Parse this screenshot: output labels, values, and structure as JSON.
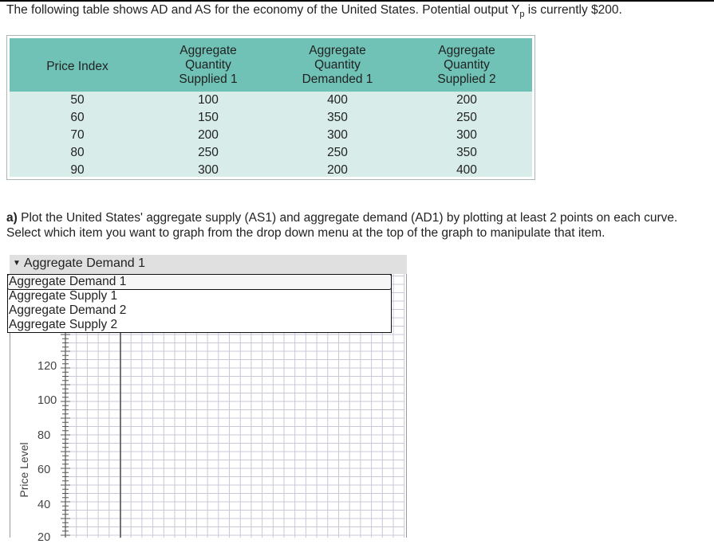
{
  "intro": {
    "text_before": "The following table shows AD and AS for the economy of the United States. Potential output Y",
    "subscript": "p",
    "text_after": " is currently $200."
  },
  "table": {
    "headers": [
      [
        "Price Index"
      ],
      [
        "Aggregate",
        "Quantity",
        "Supplied 1"
      ],
      [
        "Aggregate",
        "Quantity",
        "Demanded 1"
      ],
      [
        "Aggregate",
        "Quantity",
        "Supplied 2"
      ]
    ],
    "rows": [
      [
        "50",
        "100",
        "400",
        "200"
      ],
      [
        "60",
        "150",
        "350",
        "250"
      ],
      [
        "70",
        "200",
        "300",
        "300"
      ],
      [
        "80",
        "250",
        "250",
        "350"
      ],
      [
        "90",
        "300",
        "200",
        "400"
      ]
    ]
  },
  "question": {
    "label": "a)",
    "line1": " Plot the United States' aggregate supply (AS1) and aggregate demand (AD1) by plotting at least 2 points on each curve.",
    "line2": "Select which item you want to graph from the drop down menu at the top of the graph to manipulate that item."
  },
  "graph": {
    "selected_label": "Aggregate Demand 1",
    "dropdown_options": [
      "Aggregate Demand 1",
      "Aggregate Supply 1",
      "Aggregate Demand 2",
      "Aggregate Supply 2"
    ],
    "y_axis_label": "Price Level",
    "y_ticks": [
      "120",
      "100",
      "80",
      "60",
      "40",
      "20"
    ]
  },
  "colors": {
    "header_teal": "#6fc2b5",
    "body_mint": "#d8ece9",
    "grid_line": "#c8c8d8"
  }
}
